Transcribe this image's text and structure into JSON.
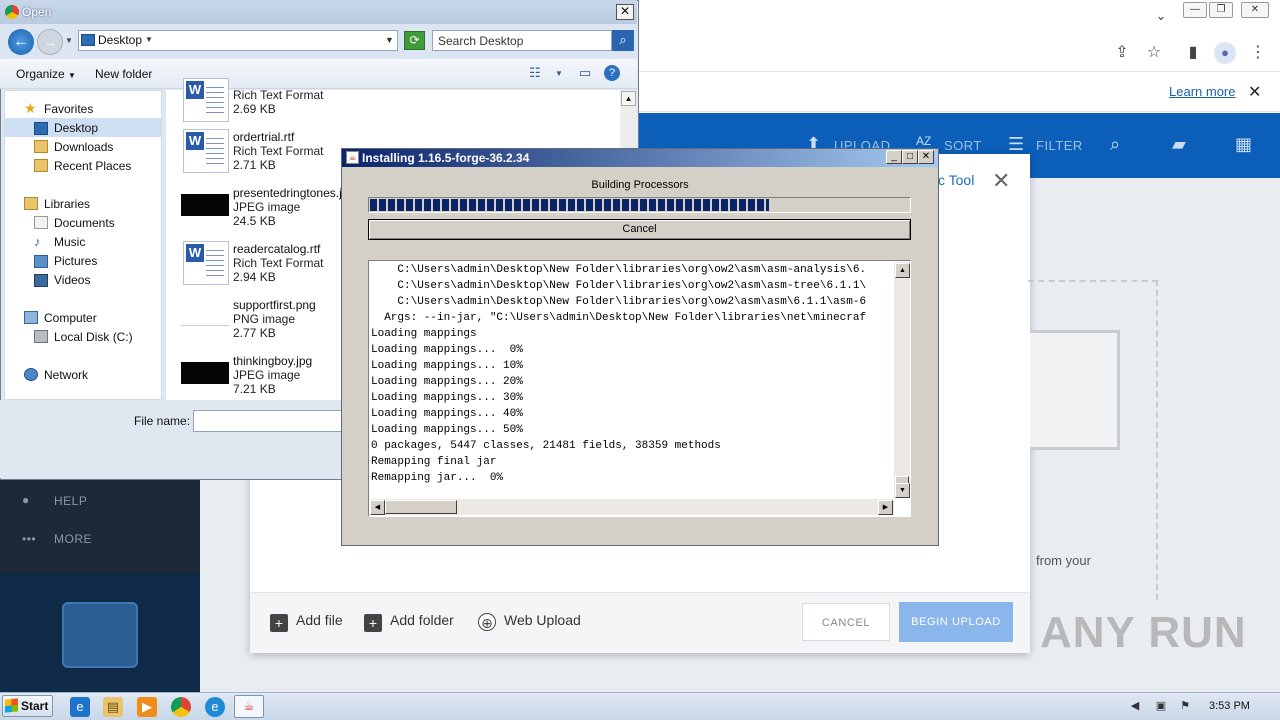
{
  "browser": {
    "learn_more": "Learn more",
    "cookie_close": "✕"
  },
  "app": {
    "header": {
      "upload": "UPLOAD",
      "sort": "SORT",
      "filter": "FILTER"
    },
    "sidebar": {
      "help": "HELP",
      "more": "MORE"
    },
    "modal": {
      "title_fragment": "c Tool",
      "close": "✕",
      "from_your": "from your",
      "add_file": "Add file",
      "add_folder": "Add folder",
      "web_upload": "Web Upload",
      "cancel": "CANCEL",
      "begin_upload": "BEGIN UPLOAD"
    },
    "watermark": "ANY RUN"
  },
  "open_dialog": {
    "title": "Open",
    "address": "Desktop",
    "search_placeholder": "Search Desktop",
    "organize": "Organize",
    "new_folder": "New folder",
    "nav": {
      "favorites": "Favorites",
      "desktop": "Desktop",
      "downloads": "Downloads",
      "recent_places": "Recent Places",
      "libraries": "Libraries",
      "documents": "Documents",
      "music": "Music",
      "pictures": "Pictures",
      "videos": "Videos",
      "computer": "Computer",
      "local_disk": "Local Disk (C:)",
      "network": "Network"
    },
    "files": [
      {
        "name": "",
        "type": "Rich Text Format",
        "size": "2.69 KB"
      },
      {
        "name": "ordertrial.rtf",
        "type": "Rich Text Format",
        "size": "2.71 KB"
      },
      {
        "name": "presentedringtones.jp",
        "type": "JPEG image",
        "size": "24.5 KB"
      },
      {
        "name": "readercatalog.rtf",
        "type": "Rich Text Format",
        "size": "2.94 KB"
      },
      {
        "name": "supportfirst.png",
        "type": "PNG image",
        "size": "2.77 KB"
      },
      {
        "name": "thinkingboy.jpg",
        "type": "JPEG image",
        "size": "7.21 KB"
      }
    ],
    "file_name_label": "File name:"
  },
  "installer": {
    "title": "Installing 1.16.5-forge-36.2.34",
    "status": "Building Processors",
    "progress": 0.74,
    "cancel": "Cancel",
    "log": [
      "    C:\\Users\\admin\\Desktop\\New Folder\\libraries\\org\\ow2\\asm\\asm-analysis\\6.",
      "    C:\\Users\\admin\\Desktop\\New Folder\\libraries\\org\\ow2\\asm\\asm-tree\\6.1.1\\",
      "    C:\\Users\\admin\\Desktop\\New Folder\\libraries\\org\\ow2\\asm\\asm\\6.1.1\\asm-6",
      "  Args: --in-jar, \"C:\\Users\\admin\\Desktop\\New Folder\\libraries\\net\\minecraf",
      "Loading mappings",
      "Loading mappings...  0%",
      "Loading mappings... 10%",
      "Loading mappings... 20%",
      "Loading mappings... 30%",
      "Loading mappings... 40%",
      "Loading mappings... 50%",
      "0 packages, 5447 classes, 21481 fields, 38359 methods",
      "Remapping final jar",
      "Remapping jar...  0%"
    ]
  },
  "taskbar": {
    "start": "Start",
    "clock": "3:53 PM"
  }
}
